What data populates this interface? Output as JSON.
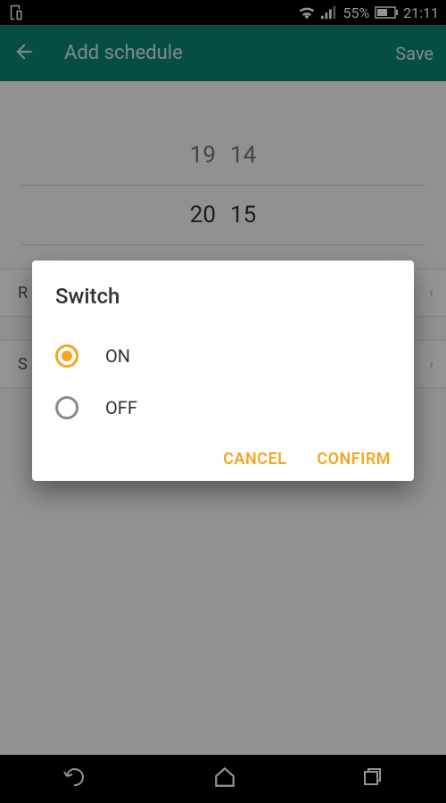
{
  "status_bar": {
    "battery_percent": "55%",
    "clock": "21:11"
  },
  "header": {
    "title": "Add schedule",
    "save_label": "Save"
  },
  "time_picker": {
    "prev_hour": "19",
    "prev_minute": "14",
    "sel_hour": "20",
    "sel_minute": "15"
  },
  "rows": {
    "repeat_partial": "R",
    "second_partial": "S"
  },
  "dialog": {
    "title": "Switch",
    "options": [
      {
        "label": "ON",
        "selected": true
      },
      {
        "label": "OFF",
        "selected": false
      }
    ],
    "cancel_label": "CANCEL",
    "confirm_label": "CONFIRM"
  },
  "colors": {
    "accent": "#f5a623",
    "header_bg": "#0c8676"
  }
}
